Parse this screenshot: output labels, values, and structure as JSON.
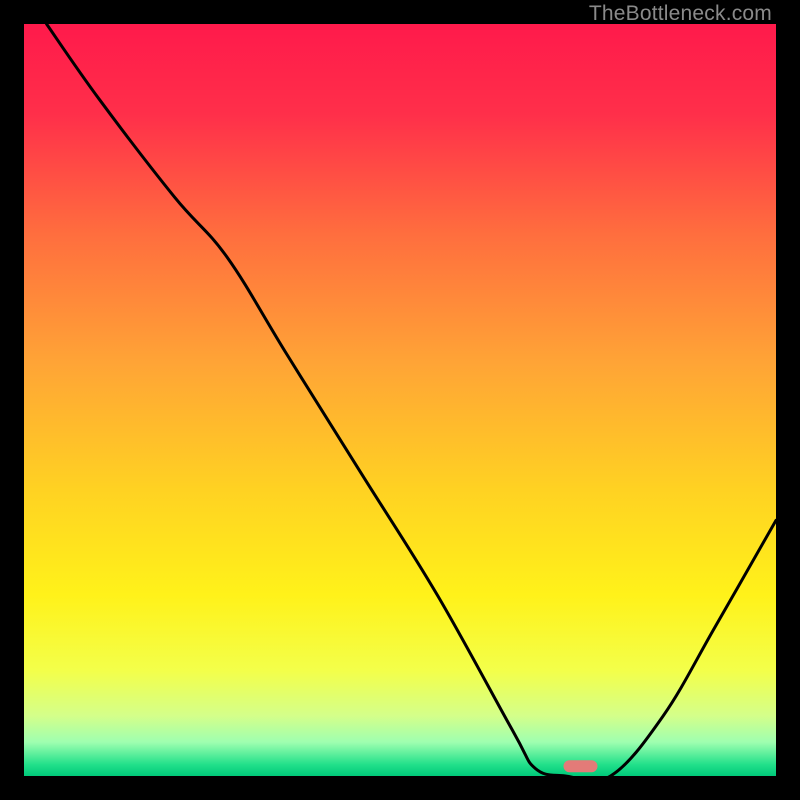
{
  "watermark": "TheBottleneck.com",
  "chart_data": {
    "type": "line",
    "title": "",
    "xlabel": "",
    "ylabel": "",
    "xlim": [
      0,
      100
    ],
    "ylim": [
      0,
      100
    ],
    "grid": false,
    "legend": false,
    "series": [
      {
        "name": "bottleneck-curve",
        "x": [
          3,
          10,
          20,
          27,
          35,
          45,
          55,
          65,
          68,
          72,
          78,
          85,
          92,
          100
        ],
        "y": [
          100,
          90,
          77,
          69,
          56,
          40,
          24,
          6,
          1,
          0,
          0,
          8,
          20,
          34
        ]
      }
    ],
    "marker": {
      "name": "selected-point",
      "x": 74,
      "y": 1.3,
      "color": "#e37b78"
    },
    "gradient_stops": [
      {
        "offset": 0.0,
        "color": "#ff1a4b"
      },
      {
        "offset": 0.12,
        "color": "#ff2f4a"
      },
      {
        "offset": 0.28,
        "color": "#ff6e3e"
      },
      {
        "offset": 0.45,
        "color": "#ffa436"
      },
      {
        "offset": 0.62,
        "color": "#ffd222"
      },
      {
        "offset": 0.76,
        "color": "#fff21a"
      },
      {
        "offset": 0.86,
        "color": "#f3ff4a"
      },
      {
        "offset": 0.92,
        "color": "#d4ff8a"
      },
      {
        "offset": 0.955,
        "color": "#9fffb0"
      },
      {
        "offset": 0.985,
        "color": "#21e08a"
      },
      {
        "offset": 1.0,
        "color": "#00c97a"
      }
    ]
  }
}
